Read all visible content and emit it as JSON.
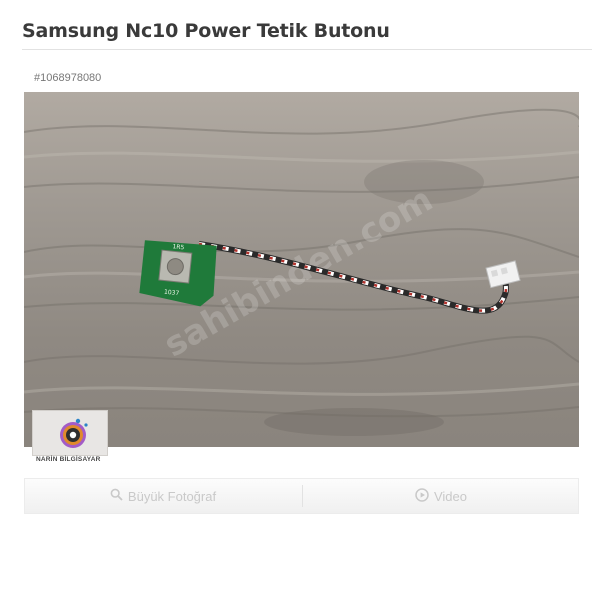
{
  "listing": {
    "title": "Samsung Nc10 Power Tetik Butonu",
    "id": "#1068978080"
  },
  "photo": {
    "watermark_text": "sahibinden.com",
    "pcb_label_top": "1R5",
    "pcb_label_bottom": "1037"
  },
  "store_logo": {
    "caption": "NARİN BİLGİSAYAR"
  },
  "media_tabs": {
    "large_photo_label": "Büyük Fotoğraf",
    "video_label": "Video"
  },
  "icons": {
    "large_photo": "magnifier-icon",
    "video": "play-circle-icon"
  },
  "colors": {
    "pcb_green": "#1f7a3a",
    "tab_text": "#c9c9c9"
  }
}
